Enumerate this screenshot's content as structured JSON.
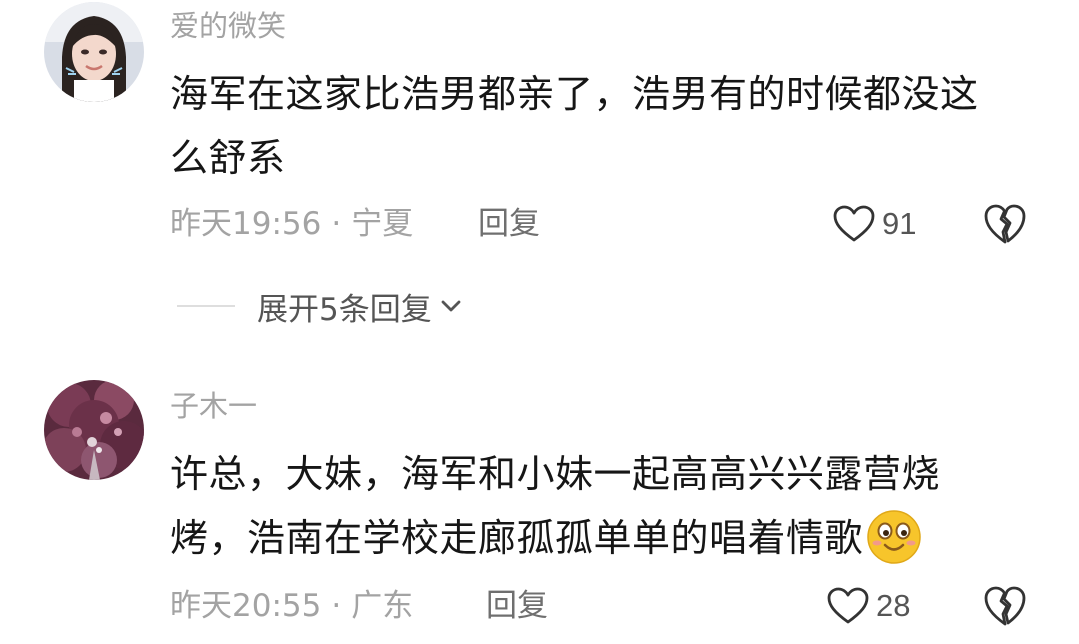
{
  "comments": [
    {
      "username": "爱的微笑",
      "text_line1": "海军在这家比浩男都亲了，浩男有的时候都没这",
      "text_line2": "么舒系",
      "time": "昨天19:56",
      "separator": "·",
      "location": "宁夏",
      "reply_label": "回复",
      "like_count": "91",
      "expand_label": "展开5条回复"
    },
    {
      "username": "子木一",
      "text_line1": "许总，大妹，海军和小妹一起高高兴兴露营烧",
      "text_line2": "烤，浩南在学校走廊孤孤单单的唱着情歌",
      "time": "昨天20:55",
      "separator": "·",
      "location": "广东",
      "reply_label": "回复",
      "like_count": "28"
    }
  ],
  "icons": {
    "like": "heart-outline-icon",
    "dislike": "broken-heart-icon",
    "expand": "chevron-down-icon",
    "inline_emoji": "smiling-face-emoji"
  },
  "colors": {
    "text_primary": "#161616",
    "text_secondary": "#a3a3a3",
    "action_text": "#555555",
    "emoji_yellow": "#f7c52b"
  }
}
